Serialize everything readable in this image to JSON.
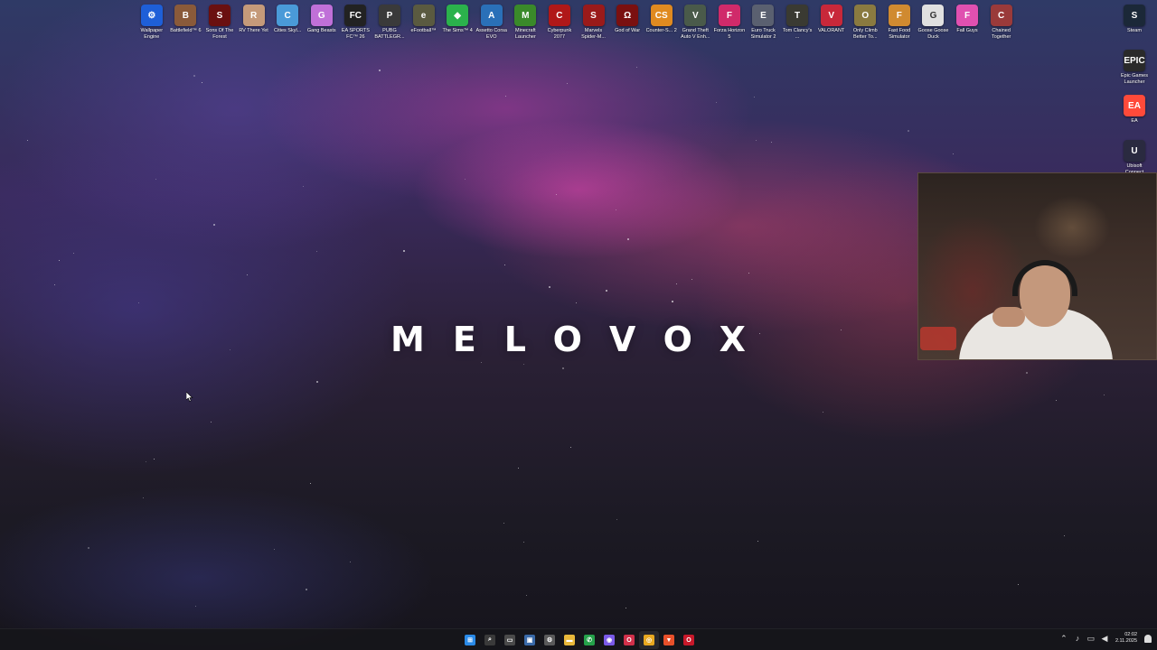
{
  "desktop": {
    "logo_text": "MELOVOX",
    "icons_top": [
      {
        "label": "Wallpaper Engine",
        "icon": "wallpaper-engine-icon",
        "color": "#1e5fd8",
        "glyph": "⚙"
      },
      {
        "label": "Battlefield™ 6",
        "icon": "battlefield-icon",
        "color": "#8a5a3a",
        "glyph": "B"
      },
      {
        "label": "Sons Of The Forest",
        "icon": "sons-of-the-forest-icon",
        "color": "#6a1010",
        "glyph": "S"
      },
      {
        "label": "RV There Yet",
        "icon": "rv-there-yet-icon",
        "color": "#c59a7a",
        "glyph": "R"
      },
      {
        "label": "Cities Skyl...",
        "icon": "cities-skylines-icon",
        "color": "#4a9ad8",
        "glyph": "C"
      },
      {
        "label": "Gang Beasts",
        "icon": "gang-beasts-icon",
        "color": "#c070d8",
        "glyph": "G"
      },
      {
        "label": "EA SPORTS FC™ 26",
        "icon": "ea-sports-fc-icon",
        "color": "#222222",
        "glyph": "FC"
      },
      {
        "label": "PUBG BATTLEGR...",
        "icon": "pubg-icon",
        "color": "#3a3a3a",
        "glyph": "P"
      },
      {
        "label": "eFootball™",
        "icon": "efootball-icon",
        "color": "#5a5a40",
        "glyph": "e"
      },
      {
        "label": "The Sims™ 4",
        "icon": "the-sims-icon",
        "color": "#2bb24c",
        "glyph": "◆"
      },
      {
        "label": "Assetto Corsa EVO",
        "icon": "assetto-corsa-icon",
        "color": "#2a70b8",
        "glyph": "A"
      },
      {
        "label": "Minecraft Launcher",
        "icon": "minecraft-icon",
        "color": "#3a8a2a",
        "glyph": "M"
      },
      {
        "label": "Cyberpunk 2077",
        "icon": "cyberpunk-icon",
        "color": "#b01818",
        "glyph": "C"
      },
      {
        "label": "Marvels Spider-M...",
        "icon": "spider-man-icon",
        "color": "#9a1a1a",
        "glyph": "S"
      },
      {
        "label": "God of War",
        "icon": "god-of-war-icon",
        "color": "#7a1010",
        "glyph": "Ω"
      },
      {
        "label": "Counter-S... 2",
        "icon": "counter-strike-icon",
        "color": "#e08a20",
        "glyph": "CS"
      },
      {
        "label": "Grand Theft Auto V Enh...",
        "icon": "gta-v-icon",
        "color": "#4a5a4a",
        "glyph": "V"
      },
      {
        "label": "Forza Horizon 5",
        "icon": "forza-horizon-icon",
        "color": "#d02a6a",
        "glyph": "F"
      },
      {
        "label": "Euro Truck Simulator 2",
        "icon": "euro-truck-icon",
        "color": "#5a6070",
        "glyph": "E"
      },
      {
        "label": "Tom Clancy's ...",
        "icon": "tom-clancys-icon",
        "color": "#3a3a32",
        "glyph": "T"
      },
      {
        "label": "VALORANT",
        "icon": "valorant-icon",
        "color": "#c8283a",
        "glyph": "V"
      },
      {
        "label": "Only Climb Better To...",
        "icon": "only-climb-icon",
        "color": "#8a7a40",
        "glyph": "O"
      },
      {
        "label": "Fast Food Simulator",
        "icon": "fast-food-icon",
        "color": "#d08a30",
        "glyph": "F"
      },
      {
        "label": "Goose Goose Duck",
        "icon": "goose-goose-duck-icon",
        "color": "#e0e0e0",
        "glyph": "G"
      },
      {
        "label": "Fall Guys",
        "icon": "fall-guys-icon",
        "color": "#e050b0",
        "glyph": "F"
      },
      {
        "label": "Chained Together",
        "icon": "chained-together-icon",
        "color": "#9a3a3a",
        "glyph": "C"
      }
    ],
    "icons_right": [
      {
        "label": "Steam",
        "icon": "steam-icon",
        "color": "#1b2838",
        "glyph": "S"
      },
      {
        "label": "Epic Games Launcher",
        "icon": "epic-games-icon",
        "color": "#2a2a2a",
        "glyph": "EPIC"
      },
      {
        "label": "EA",
        "icon": "ea-app-icon",
        "color": "#ff4a3a",
        "glyph": "EA"
      },
      {
        "label": "Ubisoft Connect",
        "icon": "ubisoft-icon",
        "color": "#2a2a40",
        "glyph": "U"
      }
    ]
  },
  "taskbar": {
    "apps": [
      {
        "name": "start-button",
        "icon": "windows-logo-icon",
        "color": "#2a8ae8",
        "glyph": "⊞"
      },
      {
        "name": "search-button",
        "icon": "search-icon",
        "color": "#3a3a3a",
        "glyph": "⌕"
      },
      {
        "name": "task-view-button",
        "icon": "task-view-icon",
        "color": "#4a4a4a",
        "glyph": "▭"
      },
      {
        "name": "store-button",
        "icon": "store-icon",
        "color": "#3a6aa8",
        "glyph": "▣"
      },
      {
        "name": "settings-button",
        "icon": "gear-icon",
        "color": "#5a5a5a",
        "glyph": "⚙"
      },
      {
        "name": "file-explorer-button",
        "icon": "folder-icon",
        "color": "#e8b83a",
        "glyph": "▬"
      },
      {
        "name": "whatsapp-button",
        "icon": "whatsapp-icon",
        "color": "#25a24a",
        "glyph": "✆"
      },
      {
        "name": "messenger-button",
        "icon": "messenger-icon",
        "color": "#7a5ae8",
        "glyph": "◉"
      },
      {
        "name": "opera-gx-button",
        "icon": "opera-gx-icon",
        "color": "#d0304a",
        "glyph": "O"
      },
      {
        "name": "chrome-button",
        "icon": "chrome-icon",
        "color": "#e8a820",
        "glyph": "◎"
      },
      {
        "name": "brave-button",
        "icon": "brave-icon",
        "color": "#e8502a",
        "glyph": "▼"
      },
      {
        "name": "opera-button",
        "icon": "opera-icon",
        "color": "#c8182a",
        "glyph": "O"
      }
    ],
    "tray": {
      "clock_time": "02:02",
      "clock_date": "2.11.2025"
    }
  }
}
